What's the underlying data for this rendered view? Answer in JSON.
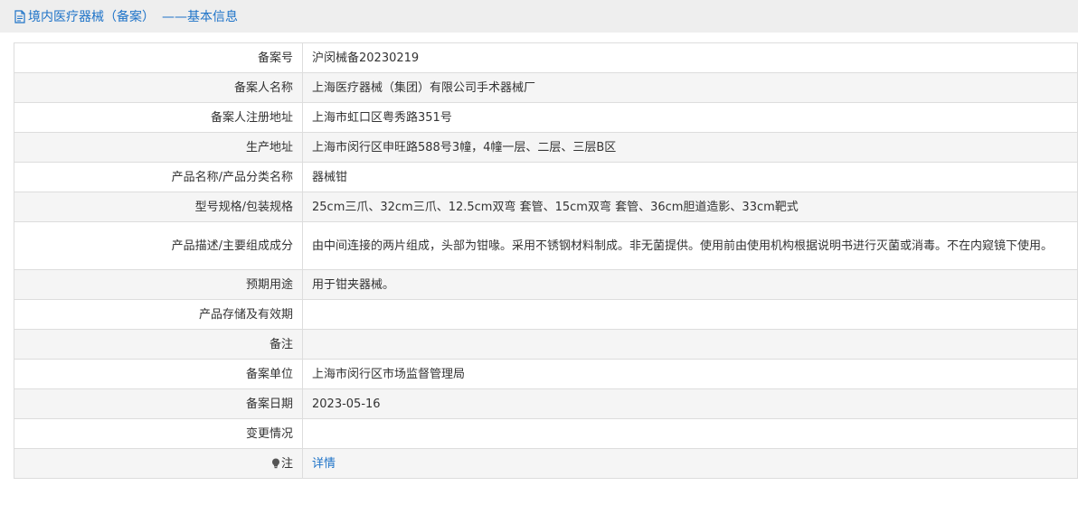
{
  "header": {
    "title": "境内医疗器械（备案）",
    "subtitle": "——基本信息"
  },
  "rows": [
    {
      "label": "备案号",
      "value": "沪闵械备20230219"
    },
    {
      "label": "备案人名称",
      "value": "上海医疗器械（集团）有限公司手术器械厂"
    },
    {
      "label": "备案人注册地址",
      "value": "上海市虹口区粤秀路351号"
    },
    {
      "label": "生产地址",
      "value": "上海市闵行区申旺路588号3幢，4幢一层、二层、三层B区"
    },
    {
      "label": "产品名称/产品分类名称",
      "value": "器械钳"
    },
    {
      "label": "型号规格/包装规格",
      "value": "25cm三爪、32cm三爪、12.5cm双弯 套管、15cm双弯 套管、36cm胆道造影、33cm靶式"
    },
    {
      "label": "产品描述/主要组成成分",
      "value": "由中间连接的两片组成，头部为钳喙。采用不锈钢材料制成。非无菌提供。使用前由使用机构根据说明书进行灭菌或消毒。不在内窥镜下使用。"
    },
    {
      "label": "预期用途",
      "value": "用于钳夹器械。"
    },
    {
      "label": "产品存储及有效期",
      "value": ""
    },
    {
      "label": "备注",
      "value": ""
    },
    {
      "label": "备案单位",
      "value": "上海市闵行区市场监督管理局"
    },
    {
      "label": "备案日期",
      "value": "2023-05-16"
    },
    {
      "label": "变更情况",
      "value": ""
    },
    {
      "label": "注",
      "value": "详情"
    }
  ],
  "icons": {
    "title": "document-icon",
    "note": "lightbulb-icon"
  },
  "colors": {
    "link": "#1e73c8",
    "header_bg": "#eeeeee",
    "alt_row_bg": "#f5f5f5",
    "border": "#dddddd"
  }
}
